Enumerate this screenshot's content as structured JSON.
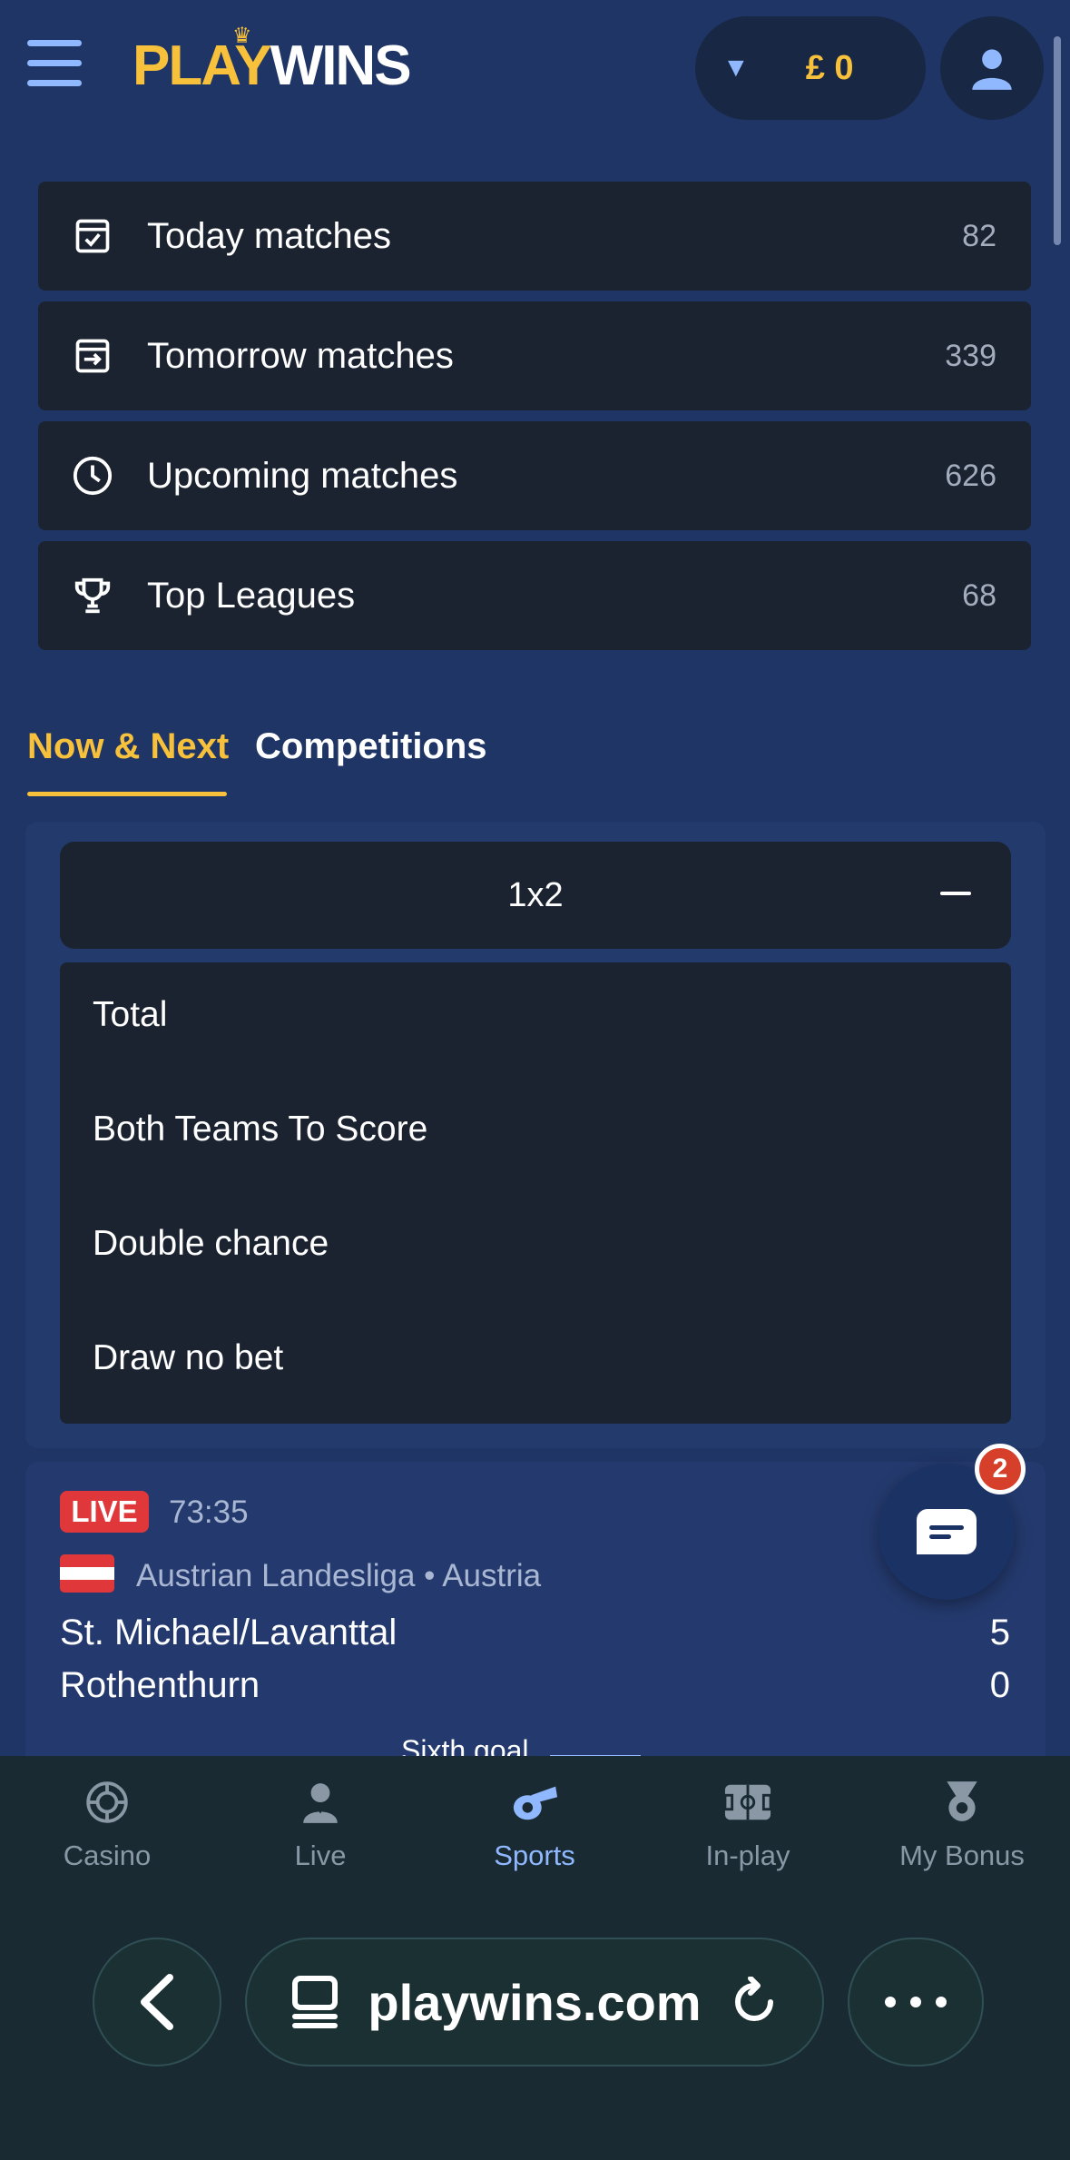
{
  "header": {
    "logo_play": "PLAY",
    "logo_wins": "WINS",
    "balance": "£ 0"
  },
  "quick_menu": [
    {
      "label": "Today matches",
      "count": "82",
      "icon": "calendar-check-icon"
    },
    {
      "label": "Tomorrow matches",
      "count": "339",
      "icon": "calendar-arrow-icon"
    },
    {
      "label": "Upcoming matches",
      "count": "626",
      "icon": "clock-icon"
    },
    {
      "label": "Top Leagues",
      "count": "68",
      "icon": "trophy-icon"
    }
  ],
  "tabs": {
    "active": "Now & Next",
    "other": "Competitions"
  },
  "market": {
    "selected": "1x2",
    "options": [
      "Total",
      "Both Teams To Score",
      "Double chance",
      "Draw no bet"
    ]
  },
  "match": {
    "live_label": "LIVE",
    "time": "73:35",
    "league": "Austrian Landesliga • Austria",
    "home_team": "St. Michael/Lavanttal",
    "home_score": "5",
    "away_team": "Rothenthurn",
    "away_score": "0",
    "market_hint": "Sixth goal"
  },
  "chat": {
    "badge": "2"
  },
  "bottom_nav": [
    {
      "label": "Casino",
      "icon": "roulette-icon"
    },
    {
      "label": "Live",
      "icon": "dealer-icon"
    },
    {
      "label": "Sports",
      "icon": "whistle-icon"
    },
    {
      "label": "In-play",
      "icon": "football-pitch-icon"
    },
    {
      "label": "My Bonus",
      "icon": "medal-icon"
    }
  ],
  "browser": {
    "url": "playwins.com"
  },
  "colors": {
    "accent": "#f7c13c",
    "active_blue": "#8fb8ff",
    "live_red": "#e0373a",
    "background": "#1f3566",
    "card": "#1b2330"
  }
}
